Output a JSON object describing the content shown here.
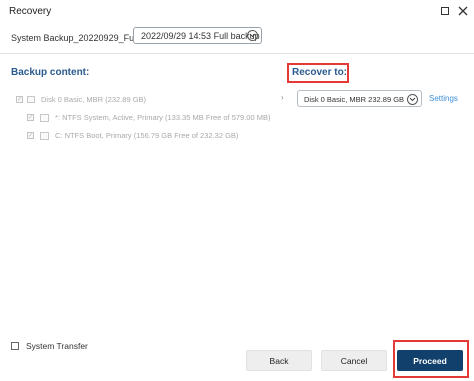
{
  "window": {
    "title": "Recovery"
  },
  "backup": {
    "name": "System Backup_20220929_Full_v1",
    "selected": "2022/09/29 14:53 Full backup"
  },
  "backup_content": {
    "header": "Backup content:",
    "disk": {
      "label": "Disk 0 Basic, MBR (232.89 GB)"
    },
    "partitions": [
      {
        "label": "*: NTFS System, Active, Primary (133.35 MB Free of 579.00 MB)"
      },
      {
        "label": "C: NTFS Boot, Primary (156.79 GB Free of 232.32 GB)"
      }
    ]
  },
  "recover_to": {
    "header": "Recover to:",
    "target": "Disk 0 Basic, MBR 232.89 GB",
    "settings_label": "Settings"
  },
  "footer": {
    "system_transfer_label": "System Transfer",
    "back_label": "Back",
    "cancel_label": "Cancel",
    "proceed_label": "Proceed"
  },
  "colors": {
    "accent": "#2a5b8f",
    "primary_button": "#12406c",
    "highlight_box": "#e53935",
    "link": "#3f8fd6"
  }
}
